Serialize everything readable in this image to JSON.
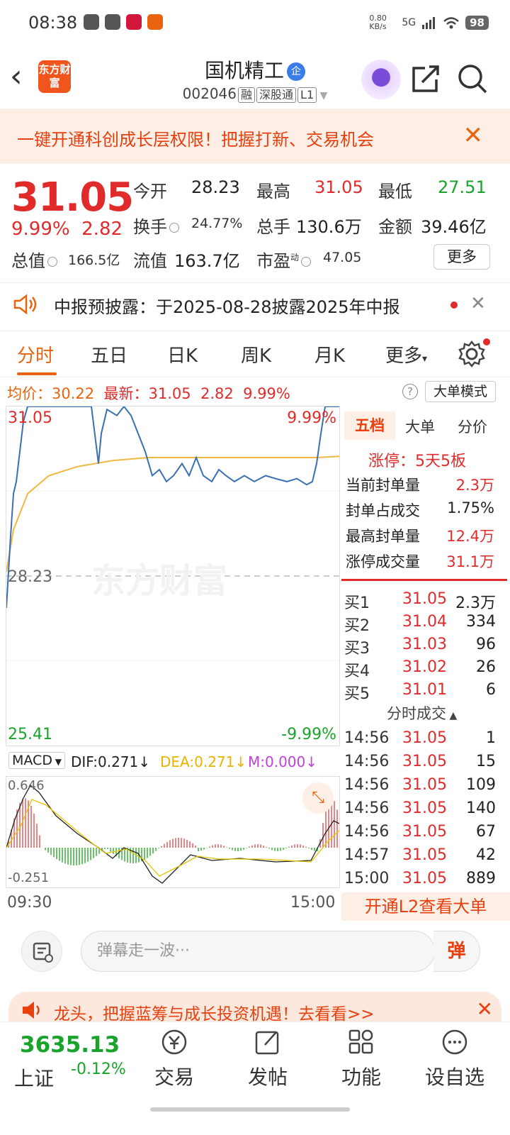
{
  "status": {
    "time": "08:38",
    "net": "0.80 KB/s",
    "signal": "5G",
    "battery": "98"
  },
  "header": {
    "back": "‹",
    "logo": "东方财富",
    "title": "国机精工",
    "title_badge": "企",
    "code": "002046",
    "tags": [
      "融",
      "深股通",
      "L1"
    ]
  },
  "banner": {
    "text": "一键开通科创成长层权限！把握打新、交易机会",
    "close": "✕"
  },
  "quote": {
    "price": "31.05",
    "change_pct": "9.99%",
    "change": "2.82",
    "open_l": "今开",
    "open": "28.23",
    "high_l": "最高",
    "high": "31.05",
    "low_l": "最低",
    "low": "27.51",
    "turn_l": "换手",
    "turn": "24.77%",
    "vol_l": "总手",
    "vol": "130.6万",
    "amt_l": "金额",
    "amt": "39.46亿",
    "mcap_l": "总值",
    "mcap": "166.5亿",
    "fcap_l": "流值",
    "fcap": "163.7亿",
    "pe_l": "市盈",
    "pe_sup": "动",
    "pe": "47.05",
    "more": "更多"
  },
  "notice": {
    "text": "中报预披露：于2025-08-28披露2025年中报",
    "close": "✕"
  },
  "tabs": [
    "分时",
    "五日",
    "日K",
    "周K",
    "月K",
    "更多"
  ],
  "chart_info": {
    "avg_l": "均价：",
    "avg": "30.22",
    "last_l": "最新：",
    "last": "31.05",
    "chg": "2.82",
    "pct": "9.99%",
    "mode": "大单模式",
    "help": "?"
  },
  "chart": {
    "top_price": "31.05",
    "top_pct": "9.99%",
    "mid_price": "28.23",
    "bot_price": "25.41",
    "bot_pct": "-9.99%",
    "watermark": "东方财富"
  },
  "macd": {
    "sel": "MACD",
    "dif": "DIF:0.271↓",
    "dea": "DEA:0.271↓",
    "m": "M:0.000↓",
    "top": "0.646",
    "bot": "-0.251",
    "t0": "09:30",
    "t1": "15:00"
  },
  "right": {
    "tabs": [
      "五档",
      "大单",
      "分价"
    ],
    "limit": "涨停：5天5板",
    "stats": [
      {
        "k": "当前封单量",
        "v": "2.3万"
      },
      {
        "k": "封单占成交",
        "v": "1.75%"
      },
      {
        "k": "最高封单量",
        "v": "12.4万"
      },
      {
        "k": "涨停成交量",
        "v": "31.1万"
      }
    ],
    "bids": [
      {
        "l": "买1",
        "p": "31.05",
        "q": "2.3万"
      },
      {
        "l": "买2",
        "p": "31.04",
        "q": "334"
      },
      {
        "l": "买3",
        "p": "31.03",
        "q": "96"
      },
      {
        "l": "买4",
        "p": "31.02",
        "q": "26"
      },
      {
        "l": "买5",
        "p": "31.01",
        "q": "6"
      }
    ],
    "trades_title": "分时成交",
    "trades": [
      {
        "t": "14:56",
        "p": "31.05",
        "q": "1"
      },
      {
        "t": "14:56",
        "p": "31.05",
        "q": "15"
      },
      {
        "t": "14:56",
        "p": "31.05",
        "q": "109"
      },
      {
        "t": "14:56",
        "p": "31.05",
        "q": "140"
      },
      {
        "t": "14:56",
        "p": "31.05",
        "q": "67"
      },
      {
        "t": "14:57",
        "p": "31.05",
        "q": "42"
      },
      {
        "t": "15:00",
        "p": "31.05",
        "q": "889"
      }
    ],
    "l2": "开通L2查看大单"
  },
  "input": {
    "placeholder": "弹幕走一波···",
    "dan": "弹"
  },
  "promo": {
    "text": "龙头，把握蓝筹与成长投资机遇！去看看>>"
  },
  "bottom": {
    "index_val": "3635.13",
    "index_name": "上证",
    "index_chg": "-0.12%",
    "nav": [
      "交易",
      "发帖",
      "功能",
      "设自选"
    ]
  },
  "colors": {
    "up": "#e12b2b",
    "down": "#1aa32a",
    "accent": "#e8640f",
    "price_line": "#3b6fb3",
    "avg_line": "#f0b840"
  }
}
